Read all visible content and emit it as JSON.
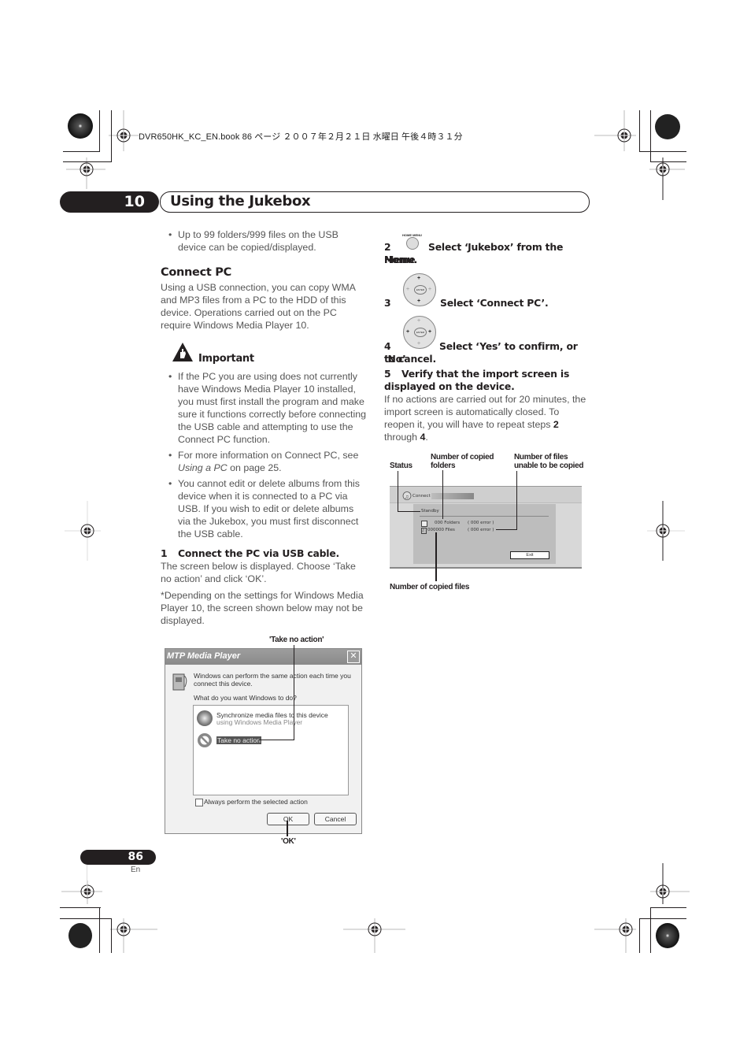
{
  "header": {
    "book_line": "DVR650HK_KC_EN.book  86 ページ  ２００７年２月２１日  水曜日  午後４時３１分"
  },
  "chapter": {
    "number": "10",
    "title": "Using the Jukebox"
  },
  "left_column": {
    "intro_bullet": "Up to 99 folders/999 files on the USB device can be copied/displayed.",
    "section_heading": "Connect PC",
    "section_intro": "Using a USB connection, you can copy WMA and MP3 files from a PC to the HDD of this device. Operations carried out on the PC require Windows Media Player 10.",
    "important": {
      "icon": "important-hand-warning-icon",
      "heading": "Important",
      "bullets": [
        "If the PC you are using does not currently have Windows Media Player 10 installed, you must first install the program and make sure it functions correctly before connecting the USB cable and attempting to use the Connect PC function.",
        {
          "before": "For more information on Connect PC, see ",
          "italic": "Using a PC",
          "after": " on page 25."
        },
        "You cannot edit or delete albums from this device when it is connected to a PC via USB. If you wish to edit or delete albums via the Jukebox, you must first disconnect the USB cable."
      ]
    },
    "step1": {
      "num": "1",
      "title": "Connect the PC via USB cable.",
      "body": "The screen below is displayed. Choose ‘Take no action’ and click ‘OK’.",
      "note": "*Depending on the settings for Windows Media Player 10, the screen shown below may not be displayed."
    }
  },
  "dialog": {
    "callout_top": "'Take no action'",
    "callout_bottom": "'OK'",
    "title": "MTP Media Player",
    "close_icon": "close-x-icon",
    "message_line1": "Windows can perform the same action each time you",
    "message_line2": "connect this device.",
    "question": "What do you want Windows to do?",
    "options": [
      {
        "label": "Synchronize media files to this device",
        "sublabel": "using Windows Media Player",
        "icon": "media-player-play-icon",
        "selected": false
      },
      {
        "label": "Take no action",
        "sublabel": "",
        "icon": "no-entry-icon",
        "selected": true
      }
    ],
    "checkbox_label": "Always perform the selected action",
    "checkbox_checked": false,
    "ok_label": "OK",
    "cancel_label": "Cancel"
  },
  "right_column": {
    "step2": {
      "num": "2",
      "button_label": "HOME MENU",
      "text_a": "Select ‘Jukebox’ from the Home",
      "text_b": "Menu."
    },
    "step3": {
      "num": "3",
      "button_label": "ENTER",
      "text": "Select ‘Connect PC’."
    },
    "step4": {
      "num": "4",
      "button_label": "ENTER",
      "text_a": "Select ‘Yes’ to confirm, or ‘No’",
      "text_b": "to cancel."
    },
    "step5": {
      "num": "5",
      "title_a": "Verify that the import screen is",
      "title_b": "displayed on the device.",
      "body_before": "If no actions are carried out for 20 minutes, the import screen is automatically closed. To reopen it, you will have to repeat steps ",
      "step_ref_a": "2",
      "body_mid": " through ",
      "step_ref_b": "4",
      "body_after": "."
    }
  },
  "import_screen": {
    "annotations": {
      "status": "Status",
      "copied_folders_a": "Number of copied",
      "copied_folders_b": "folders",
      "uncopied_a": "Number of files",
      "uncopied_b": "unable to be copied",
      "copied_files": "Number of copied files"
    },
    "title": "Connect PC",
    "status": "Standby",
    "folders_row": {
      "count": "000 Folders",
      "error": "( 000  error )"
    },
    "files_row": {
      "count": "000000 Files",
      "error": "( 000  error )"
    },
    "exit_label": "Exit"
  },
  "footer": {
    "page_number": "86",
    "language": "En"
  }
}
